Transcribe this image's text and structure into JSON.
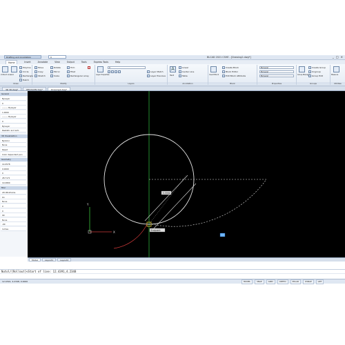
{
  "window": {
    "title": "BLCAD 2021 CSHE - [Drawing2.dwg*]",
    "workspace": "Drafting and Annotation",
    "layer_combo": "0",
    "controls": [
      "_",
      "□",
      "×"
    ]
  },
  "ribbon_tabs": [
    "Home",
    "Insert",
    "Annotate",
    "View",
    "Output",
    "Tools",
    "Express Tools",
    "Help"
  ],
  "ribbon": {
    "draw": {
      "title": "Draw",
      "big_tool": "2-Point Line",
      "big_tool2": "Arc",
      "tools": [
        "Polyline",
        "Circle",
        "Arc",
        "Rectangle",
        "Hatch"
      ]
    },
    "modify": {
      "title": "Modify",
      "tools": [
        "Move",
        "Rotate",
        "Trim",
        "Copy",
        "Mirror",
        "Fillet",
        "Stretch",
        "Scale",
        "Array",
        "Rectangular array"
      ]
    },
    "layers": {
      "title": "Layers",
      "big_tool": "Layer Properties",
      "combo": "0",
      "tools": [
        "Layer Match",
        "Layer Previous"
      ]
    },
    "annotation": {
      "title": "Annotation",
      "big_tool": "Text",
      "tools": [
        "Linear",
        "Center Line",
        "Table"
      ]
    },
    "block": {
      "title": "Block",
      "big_tool": "Insert Block",
      "tools": [
        "Create Block",
        "Block Editor",
        "Edit Block Attribute"
      ]
    },
    "properties": {
      "title": "Properties",
      "tools": [
        "ByLayer",
        "ByLayer",
        "ByLayer"
      ]
    },
    "groups": {
      "title": "Groups",
      "big_tool": "Group Manager",
      "tools": [
        "Create Group",
        "Ungroup",
        "Group Edit"
      ]
    },
    "utilities": {
      "title": "Utilities",
      "big_tool": "Measure"
    }
  },
  "doc_tabs": [
    "3D 3D.dwg*",
    "HEXAGON.dwg*",
    "Drawing2.dwg*"
  ],
  "properties_panel": {
    "sections": [
      {
        "head": "General",
        "rows": [
          "ByLayer",
          "0",
          "——— ByLayer",
          "1.0000",
          "——— ByLayer",
          "0",
          "ByLayer",
          "Realistic and anti-"
        ]
      },
      {
        "head": "3D Visualization",
        "rows": [
          "ByColor",
          "None",
          "Reset",
          "Color dependent pen"
        ]
      },
      {
        "head": "Geometry",
        "rows": [
          "14.0578",
          "0.0000",
          "0",
          "28.7171",
          "19.2800"
        ]
      },
      {
        "head": "Misc",
        "rows": [
          "2D Wireframe",
          "On",
          "None",
          "0",
          "0",
          "90",
          "None",
          "-90",
          "Inches"
        ]
      }
    ]
  },
  "canvas": {
    "dimension_label": "3.3594",
    "tooltip_label": "Endpoint",
    "axis_x_label": "X",
    "axis_y_label": "Y"
  },
  "layout_tabs": [
    "Model",
    "Layout1",
    "Layout2"
  ],
  "command_line": {
    "line1": "Nutol/[Rollout]<Start of line: 12.4391,4.2348",
    "line2": ""
  },
  "status_bar": {
    "coords": "12.4391, 4.2348, 0.0000",
    "items": [
      "MODEL",
      "SNAP",
      "GRID",
      "ORTHO",
      "POLAR",
      "OSNAP",
      "LWT"
    ]
  },
  "colors": {
    "canvas_bg": "#000000",
    "geometry": "#e6e6e6",
    "x_axis": "#d23a3a",
    "y_axis": "#3ec43e",
    "snap_marker": "#e3d23a",
    "grip": "#6fb6ff"
  }
}
